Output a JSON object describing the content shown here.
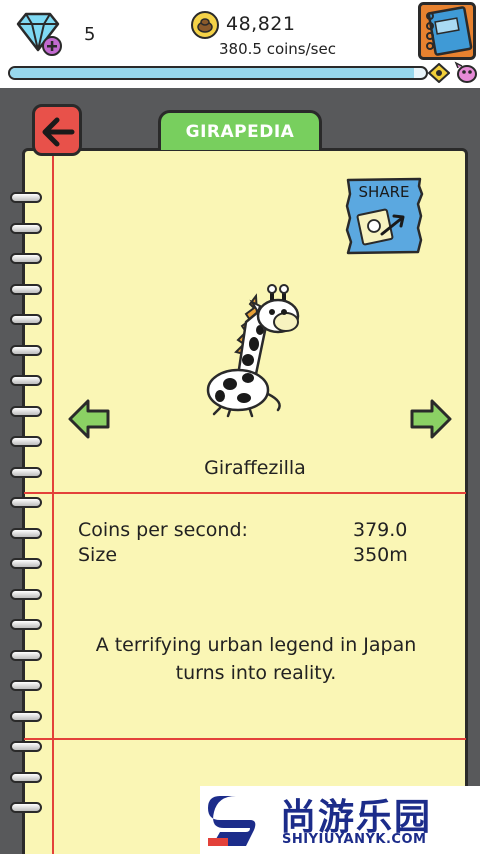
{
  "header": {
    "gems": "5",
    "coins": "48,821",
    "coin_rate": "380.5 coins/sec",
    "progress": 0.97
  },
  "tab": {
    "title": "GIRAPEDIA"
  },
  "share": {
    "label": "SHARE"
  },
  "giraffe": {
    "name": "Giraffezilla",
    "stats": [
      {
        "label": "Coins per second:",
        "value": "379.0"
      },
      {
        "label": "Size",
        "value": "350m"
      }
    ],
    "description_lines": [
      "A terrifying urban legend in Japan",
      "turns into reality."
    ]
  },
  "watermark": {
    "title": "尚游乐园",
    "subtitle": "SHIYIUYANYK.COM"
  },
  "colors": {
    "paper": "#faf6b5",
    "tab_green": "#78cf5e",
    "back_red": "#e8514a",
    "rule_red": "#e3413a",
    "progress_blue": "#97d7ec"
  }
}
